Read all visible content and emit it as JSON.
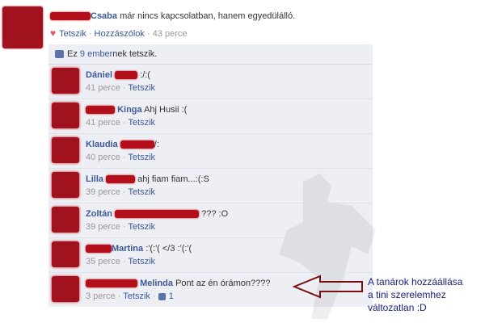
{
  "post": {
    "name": "Csaba",
    "status": "már nincs kapcsolatban, hanem egyedülálló.",
    "actions": {
      "like": "Tetszik",
      "comment": "Hozzászólok",
      "time": "43 perce"
    }
  },
  "likes": {
    "prefix": "Ez ",
    "count_link": "9 ember",
    "suffix": "nek tetszik."
  },
  "comments": [
    {
      "name": "Dániel",
      "text": ":/:(",
      "time": "41 perce",
      "like": "Tetszik"
    },
    {
      "name": "Kinga",
      "text": "Ahj Husii :(",
      "time": "41 perce",
      "like": "Tetszik"
    },
    {
      "name": "Klaudia",
      "text": "/:",
      "time": "40 perce",
      "like": "Tetszik"
    },
    {
      "name": "Lilla",
      "text": "ahj fiam fiam...:(:S",
      "time": "39 perce",
      "like": "Tetszik"
    },
    {
      "name": "Zoltán",
      "text": "??? :O",
      "time": "39 perce",
      "like": "Tetszik"
    },
    {
      "name": "Martina",
      "text": ":'(:'( </3 :'(:'(",
      "time": "35 perce",
      "like": "Tetszik"
    },
    {
      "name": "Melinda",
      "text": "Pont az én órámon????",
      "time": "3 perce",
      "like": "Tetszik",
      "like_count": "1"
    }
  ],
  "annotation": {
    "line1": "A tanárok hozzáállása",
    "line2": "a tini szerelemhez",
    "line3": "változatlan :D"
  },
  "colors": {
    "link": "#3b5998",
    "panel": "#edeff4",
    "redaction": "#a0121d",
    "arrow": "#7a0f12"
  }
}
